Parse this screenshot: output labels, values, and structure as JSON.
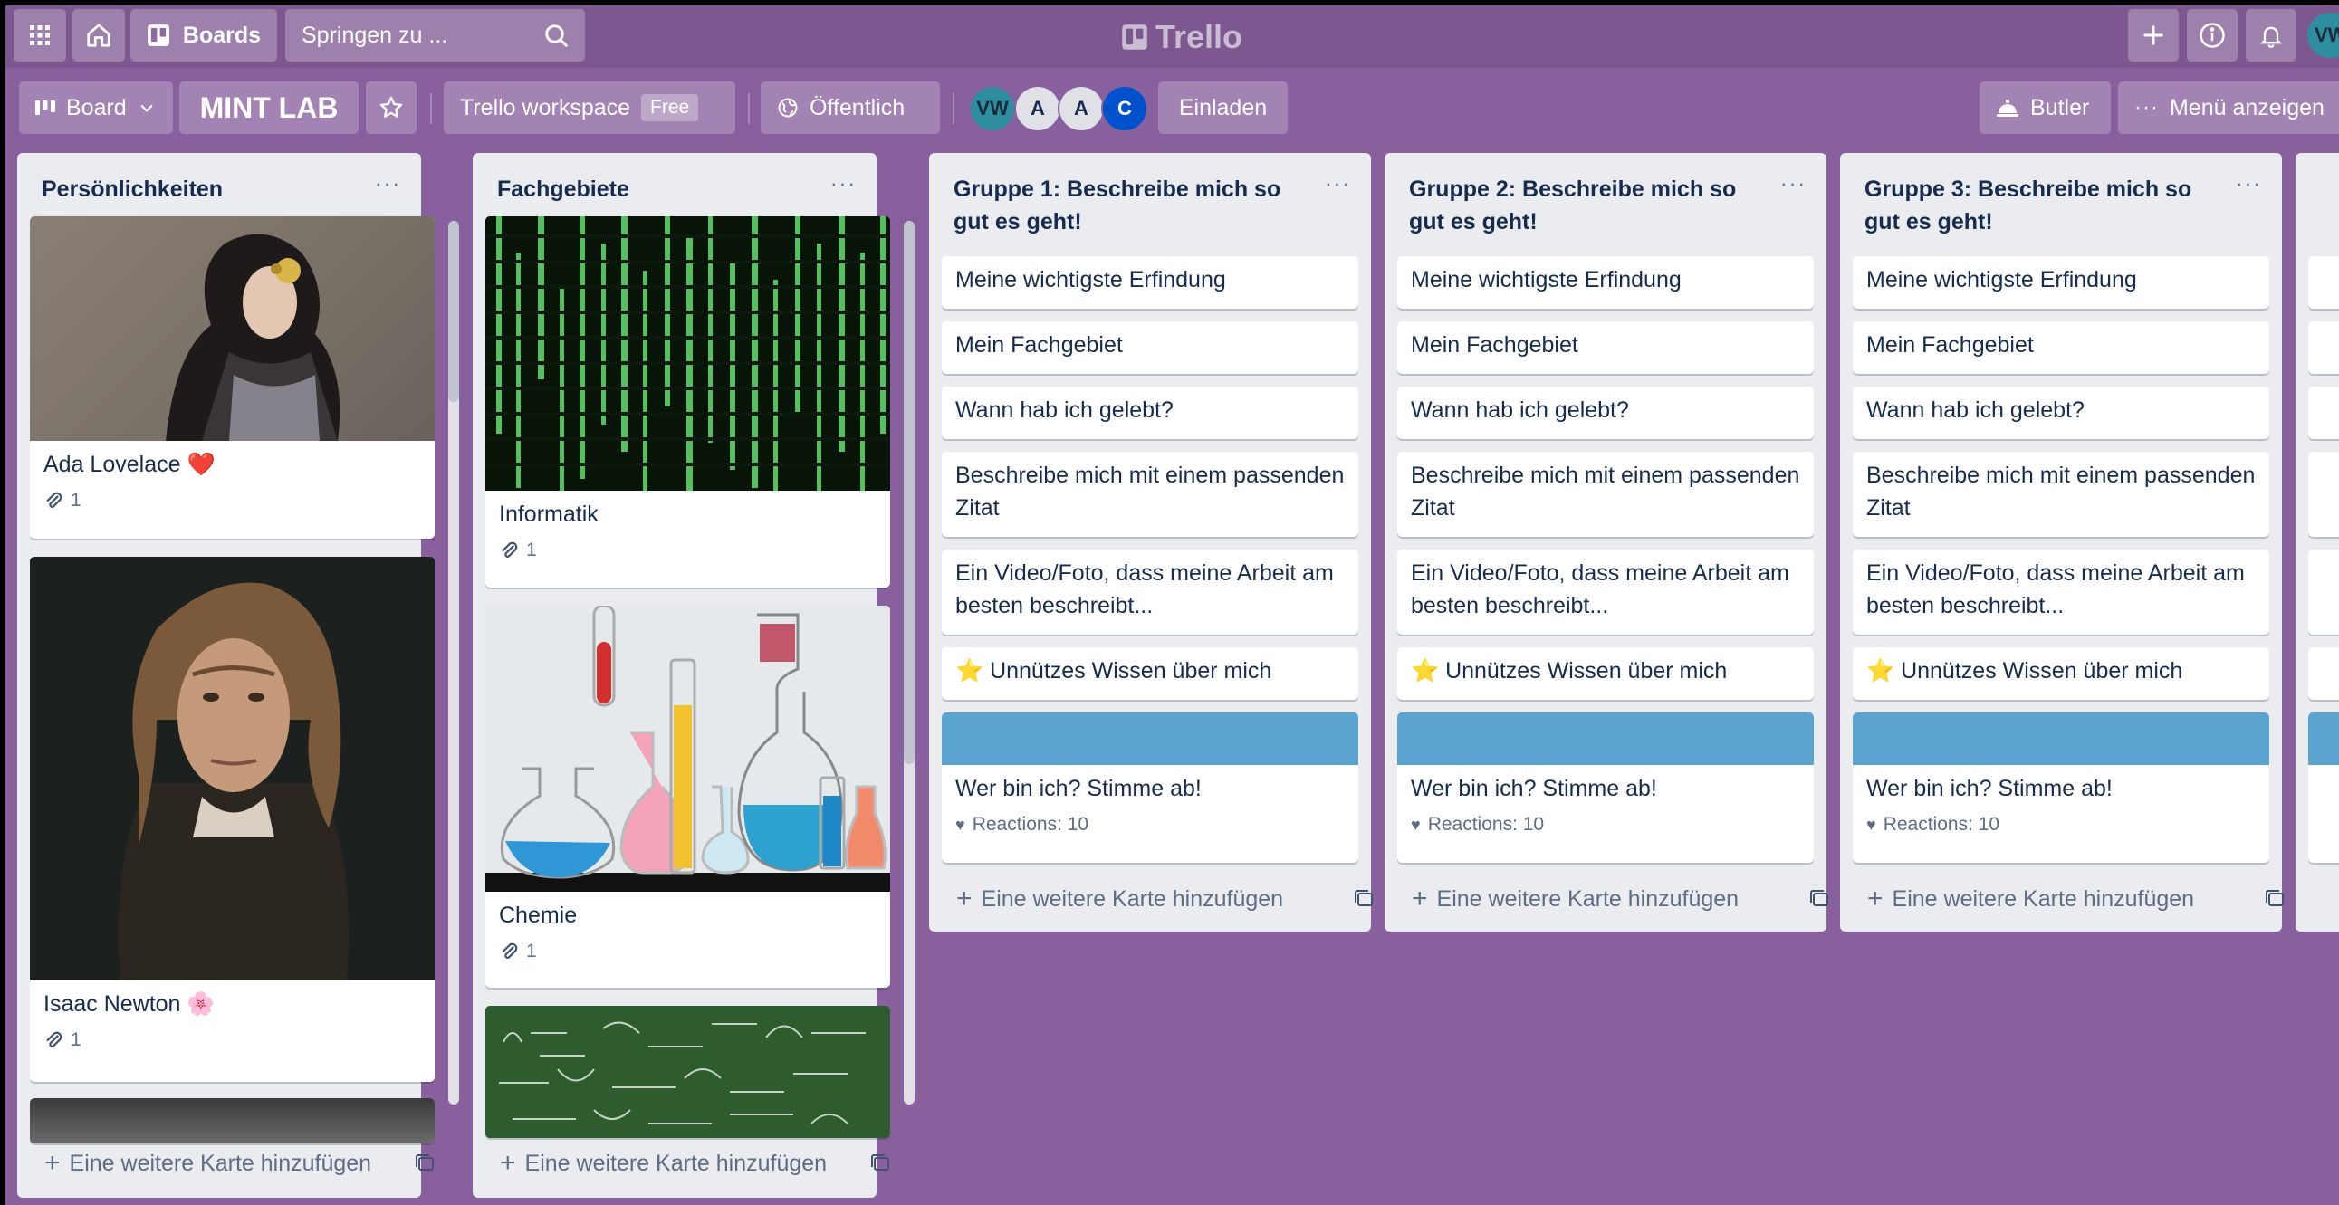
{
  "app": {
    "name": "Trello"
  },
  "topbar": {
    "boards_label": "Boards",
    "search_placeholder": "Springen zu ...",
    "user_initials": "VW"
  },
  "board": {
    "view_label": "Board",
    "title": "MINT LAB",
    "workspace_label": "Trello workspace",
    "workspace_badge": "Free",
    "visibility_label": "Öffentlich",
    "invite_label": "Einladen",
    "butler_label": "Butler",
    "menu_label": "Menü anzeigen",
    "members": [
      {
        "initials": "VW",
        "color": "#2e8ea0"
      },
      {
        "initials": "A",
        "color": "#dfe1e6"
      },
      {
        "initials": "A",
        "color": "#dfe1e6"
      },
      {
        "initials": "C",
        "color": "#0052cc"
      }
    ]
  },
  "lists": [
    {
      "title": "Persönlichkeiten",
      "cards": [
        {
          "title": "Ada Lovelace ❤️",
          "attachments": "1"
        },
        {
          "title": "Isaac Newton 🌸",
          "attachments": "1"
        }
      ],
      "add_card": "Eine weitere Karte hinzufügen"
    },
    {
      "title": "Fachgebiete",
      "cards": [
        {
          "title": "Informatik",
          "attachments": "1"
        },
        {
          "title": "Chemie",
          "attachments": "1"
        }
      ],
      "add_card": "Eine weitere Karte hinzufügen"
    },
    {
      "title": "Gruppe 1: Beschreibe mich so gut es geht!",
      "cards": [
        {
          "title": "Meine wichtigste Erfindung"
        },
        {
          "title": "Mein Fachgebiet"
        },
        {
          "title": "Wann hab ich gelebt?"
        },
        {
          "title": "Beschreibe mich mit einem passenden Zitat"
        },
        {
          "title": "Ein Video/Foto, dass meine Arbeit am besten beschreibt..."
        },
        {
          "title": "⭐ Unnützes Wissen über mich"
        },
        {
          "title": "Wer bin ich? Stimme ab!",
          "reactions": "Reactions: 10"
        }
      ],
      "add_card": "Eine weitere Karte hinzufügen"
    },
    {
      "title": "Gruppe 2: Beschreibe mich so gut es geht!",
      "cards": [
        {
          "title": "Meine wichtigste Erfindung"
        },
        {
          "title": "Mein Fachgebiet"
        },
        {
          "title": "Wann hab ich gelebt?"
        },
        {
          "title": "Beschreibe mich mit einem passenden Zitat"
        },
        {
          "title": "Ein Video/Foto, dass meine Arbeit am besten beschreibt..."
        },
        {
          "title": "⭐ Unnützes Wissen über mich"
        },
        {
          "title": "Wer bin ich? Stimme ab!",
          "reactions": "Reactions: 10"
        }
      ],
      "add_card": "Eine weitere Karte hinzufügen"
    },
    {
      "title": "Gruppe 3: Beschreibe mich so gut es geht!",
      "cards": [
        {
          "title": "Meine wichtigste Erfindung"
        },
        {
          "title": "Mein Fachgebiet"
        },
        {
          "title": "Wann hab ich gelebt?"
        },
        {
          "title": "Beschreibe mich mit einem passenden Zitat"
        },
        {
          "title": "Ein Video/Foto, dass meine Arbeit am besten beschreibt..."
        },
        {
          "title": "⭐ Unnützes Wissen über mich"
        },
        {
          "title": "Wer bin ich? Stimme ab!",
          "reactions": "Reactions: 10"
        }
      ],
      "add_card": "Eine weitere Karte hinzufügen"
    }
  ],
  "colors": {
    "board_background": "#89609e",
    "list_background": "#ebecf0",
    "card_cover_blue": "#5ba4cf",
    "heart_red": "#e0293b"
  }
}
